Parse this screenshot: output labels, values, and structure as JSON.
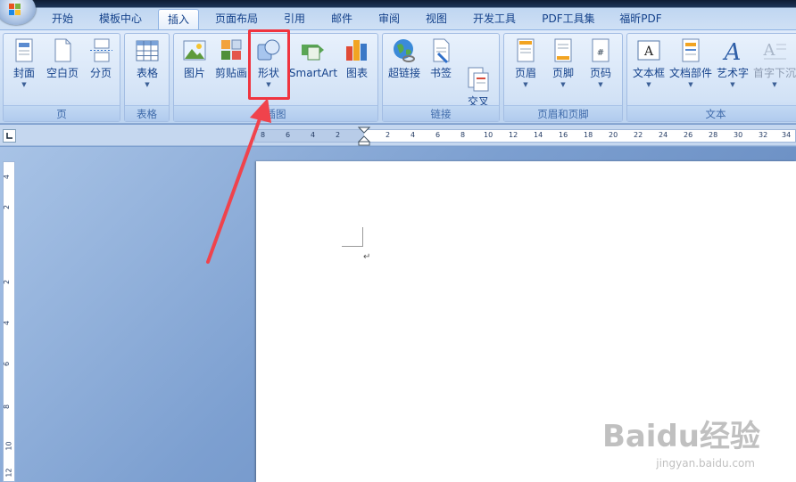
{
  "tabs": [
    "开始",
    "模板中心",
    "插入",
    "页面布局",
    "引用",
    "邮件",
    "审阅",
    "视图",
    "开发工具",
    "PDF工具集",
    "福昕PDF"
  ],
  "active_tab": "插入",
  "groups": {
    "page": {
      "label": "页",
      "buttons": [
        "封面",
        "空白页",
        "分页"
      ]
    },
    "table": {
      "label": "表格",
      "buttons": [
        "表格"
      ]
    },
    "illustration": {
      "label": "插图",
      "buttons": [
        "图片",
        "剪贴画",
        "形状",
        "SmartArt",
        "图表"
      ]
    },
    "links": {
      "label": "链接",
      "buttons": [
        "超链接",
        "书签",
        "交叉\n引用"
      ]
    },
    "header_footer": {
      "label": "页眉和页脚",
      "buttons": [
        "页眉",
        "页脚",
        "页码"
      ]
    },
    "text": {
      "label": "文本",
      "buttons": [
        "文本框",
        "文档部件",
        "艺术字",
        "首字下沉"
      ]
    }
  },
  "ruler": {
    "horizontal": [
      "8",
      "6",
      "4",
      "2",
      "2",
      "4",
      "6",
      "8",
      "10",
      "12",
      "14",
      "16",
      "18",
      "20",
      "22",
      "24",
      "26",
      "28",
      "30",
      "32",
      "34"
    ],
    "vertical": [
      "4",
      "2",
      "2",
      "4",
      "6",
      "8",
      "10",
      "12"
    ]
  },
  "document": {
    "paragraph_mark": "↵"
  },
  "watermark": {
    "logo": "Baidu经验",
    "url": "jingyan.baidu.com"
  },
  "colors": {
    "ribbon_text": "#15428b",
    "group_label": "#3e6aaa",
    "highlight": "#f0343f"
  }
}
